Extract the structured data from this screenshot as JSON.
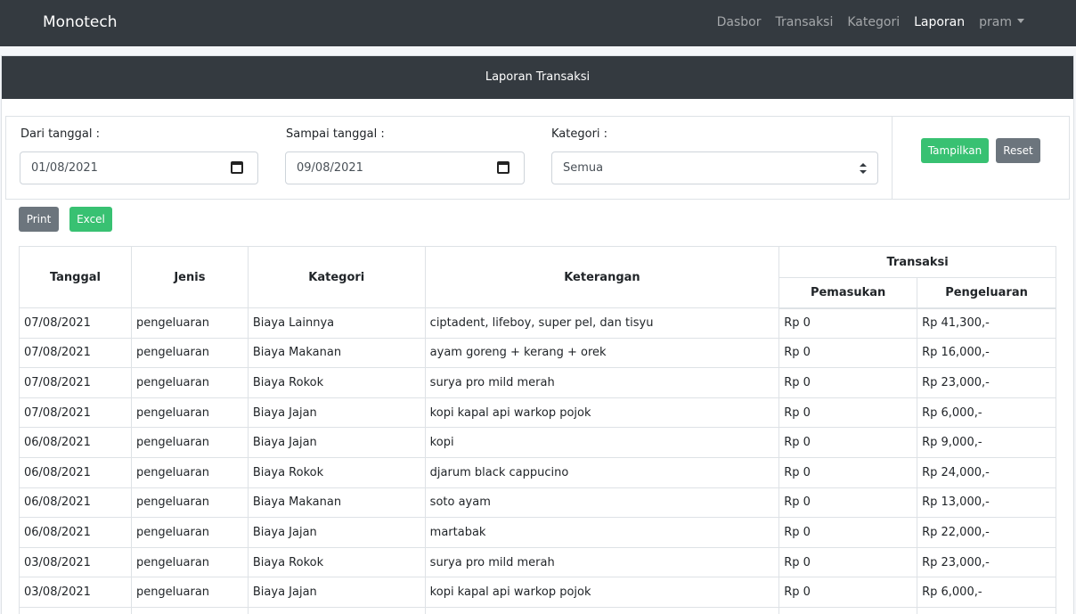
{
  "navbar": {
    "brand": "Monotech",
    "links": [
      "Dasbor",
      "Transaksi",
      "Kategori",
      "Laporan",
      "pram"
    ]
  },
  "card": {
    "title": "Laporan Transaksi"
  },
  "filters": {
    "from_label": "Dari tanggal :",
    "from_value": "01/08/2021",
    "to_label": "Sampai tanggal :",
    "to_value": "09/08/2021",
    "category_label": "Kategori :",
    "category_value": "Semua",
    "show_button": "Tampilkan",
    "reset_button": "Reset"
  },
  "actions": {
    "print": "Print",
    "excel": "Excel"
  },
  "table": {
    "headers": {
      "tanggal": "Tanggal",
      "jenis": "Jenis",
      "kategori": "Kategori",
      "keterangan": "Keterangan",
      "transaksi": "Transaksi",
      "pemasukan": "Pemasukan",
      "pengeluaran": "Pengeluaran"
    },
    "rows": [
      [
        "07/08/2021",
        "pengeluaran",
        "Biaya Lainnya",
        "ciptadent, lifeboy, super pel, dan tisyu",
        "Rp 0",
        "Rp 41,300,-"
      ],
      [
        "07/08/2021",
        "pengeluaran",
        "Biaya Makanan",
        "ayam goreng + kerang + orek",
        "Rp 0",
        "Rp 16,000,-"
      ],
      [
        "07/08/2021",
        "pengeluaran",
        "Biaya Rokok",
        "surya pro mild merah",
        "Rp 0",
        "Rp 23,000,-"
      ],
      [
        "07/08/2021",
        "pengeluaran",
        "Biaya Jajan",
        "kopi kapal api warkop pojok",
        "Rp 0",
        "Rp 6,000,-"
      ],
      [
        "06/08/2021",
        "pengeluaran",
        "Biaya Jajan",
        "kopi",
        "Rp 0",
        "Rp 9,000,-"
      ],
      [
        "06/08/2021",
        "pengeluaran",
        "Biaya Rokok",
        "djarum black cappucino",
        "Rp 0",
        "Rp 24,000,-"
      ],
      [
        "06/08/2021",
        "pengeluaran",
        "Biaya Makanan",
        "soto ayam",
        "Rp 0",
        "Rp 13,000,-"
      ],
      [
        "06/08/2021",
        "pengeluaran",
        "Biaya Jajan",
        "martabak",
        "Rp 0",
        "Rp 22,000,-"
      ],
      [
        "03/08/2021",
        "pengeluaran",
        "Biaya Rokok",
        "surya pro mild merah",
        "Rp 0",
        "Rp 23,000,-"
      ],
      [
        "03/08/2021",
        "pengeluaran",
        "Biaya Jajan",
        "kopi kapal api warkop pojok",
        "Rp 0",
        "Rp 6,000,-"
      ],
      [
        "",
        "",
        "",
        "",
        "",
        ""
      ]
    ]
  }
}
